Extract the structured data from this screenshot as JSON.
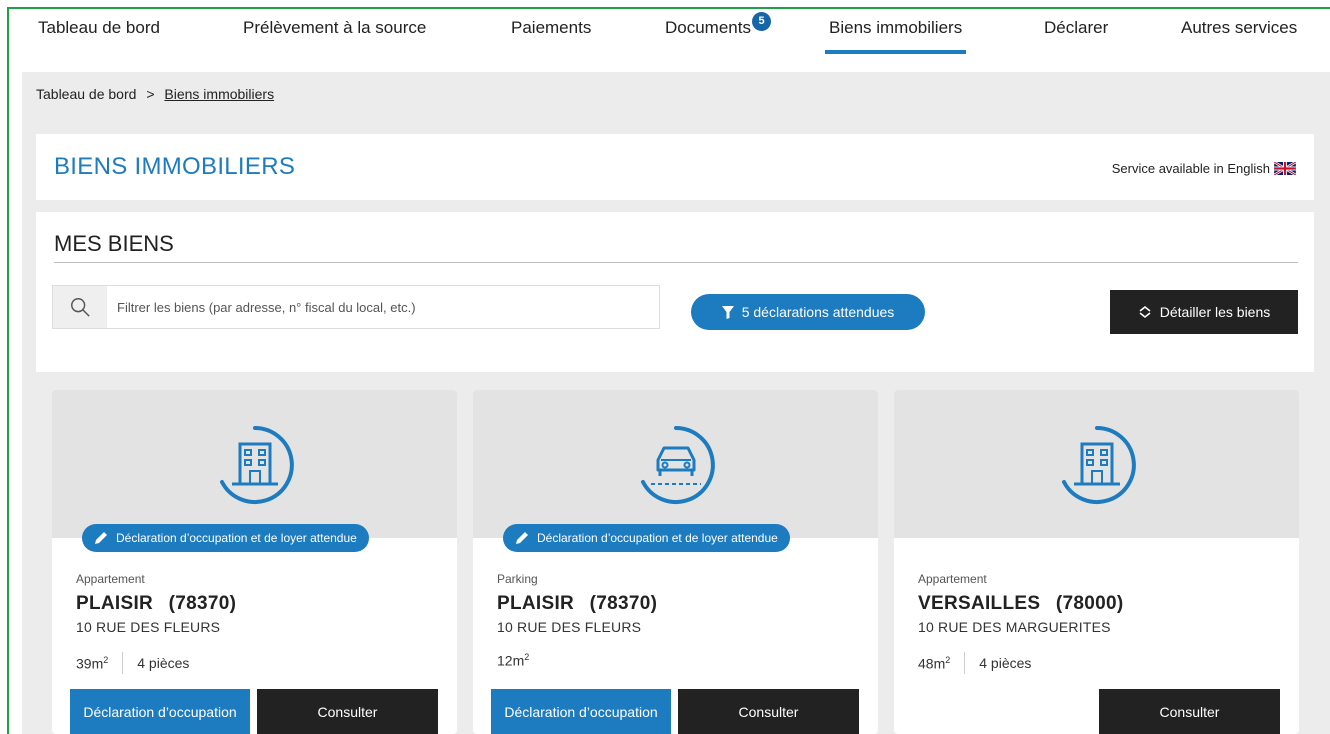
{
  "nav": {
    "items": [
      {
        "label": "Tableau de bord"
      },
      {
        "label": "Prélèvement à la source"
      },
      {
        "label": "Paiements"
      },
      {
        "label": "Documents",
        "badge": "5"
      },
      {
        "label": "Biens immobiliers",
        "active": true
      },
      {
        "label": "Déclarer"
      },
      {
        "label": "Autres services"
      }
    ]
  },
  "breadcrumb": {
    "home": "Tableau de bord",
    "separator": ">",
    "current": "Biens immobiliers"
  },
  "header": {
    "title": "BIENS IMMOBILIERS",
    "english_link": "Service available in English"
  },
  "section": {
    "title": "MES BIENS"
  },
  "search": {
    "placeholder": "Filtrer les biens (par adresse, n° fiscal du local, etc.)",
    "value": ""
  },
  "filter_button": {
    "label": "5 déclarations attendues"
  },
  "detail_button": {
    "label": "Détailler les biens"
  },
  "cards": [
    {
      "icon": "building-icon",
      "tag": "Déclaration d’occupation et de loyer attendue",
      "type": "Appartement",
      "city": "PLAISIR",
      "postcode": "(78370)",
      "street": "10 RUE DES FLEURS",
      "surface": "39m",
      "surface_unit_sup": "2",
      "rooms": "4 pièces",
      "btn_declare": "Déclaration d’occupation",
      "btn_consult": "Consulter"
    },
    {
      "icon": "car-icon",
      "tag": "Déclaration d’occupation et de loyer attendue",
      "type": "Parking",
      "city": "PLAISIR",
      "postcode": "(78370)",
      "street": "10 RUE DES FLEURS",
      "surface": "12m",
      "surface_unit_sup": "2",
      "btn_declare": "Déclaration d’occupation",
      "btn_consult": "Consulter"
    },
    {
      "icon": "building-icon",
      "type": "Appartement",
      "city": "VERSAILLES",
      "postcode": "(78000)",
      "street": "10 RUE DES MARGUERITES",
      "surface": "48m",
      "surface_unit_sup": "2",
      "rooms": "4 pièces",
      "btn_consult": "Consulter"
    }
  ],
  "colors": {
    "accent": "#1d7bbf",
    "dark": "#222222",
    "background": "#ececec",
    "frame": "#21a04a"
  }
}
